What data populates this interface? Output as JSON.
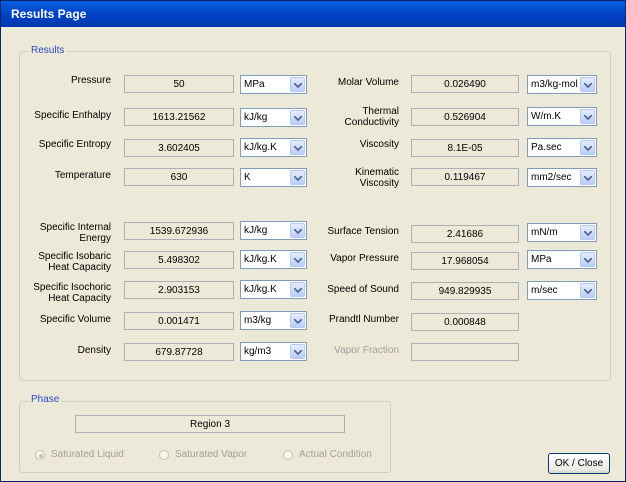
{
  "window": {
    "title": "Results Page"
  },
  "results": {
    "legend": "Results",
    "rows": [
      {
        "label": "Pressure",
        "value": "50",
        "unit": "MPa"
      },
      {
        "label": "Specific Enthalpy",
        "value": "1613.21562",
        "unit": "kJ/kg"
      },
      {
        "label": "Specific Entropy",
        "value": "3.602405",
        "unit": "kJ/kg.K"
      },
      {
        "label": "Temperature",
        "value": "630",
        "unit": "K"
      },
      {
        "label": "Specific Internal Energy",
        "value": "1539.672936",
        "unit": "kJ/kg"
      },
      {
        "label": "Specific Isobaric Heat Capacity",
        "value": "5.498302",
        "unit": "kJ/kg.K"
      },
      {
        "label": "Specific Isochoric Heat Capacity",
        "value": "2.903153",
        "unit": "kJ/kg.K"
      },
      {
        "label": "Specific Volume",
        "value": "0.001471",
        "unit": "m3/kg"
      },
      {
        "label": "Density",
        "value": "679.87728",
        "unit": "kg/m3"
      }
    ],
    "rows_right": [
      {
        "label": "Molar Volume",
        "value": "0.026490",
        "unit": "m3/kg-mol"
      },
      {
        "label": "Thermal Conductivity",
        "value": "0.526904",
        "unit": "W/m.K"
      },
      {
        "label": "Viscosity",
        "value": "8.1E-05",
        "unit": "Pa.sec"
      },
      {
        "label": "Kinematic Viscosity",
        "value": "0.119467",
        "unit": "mm2/sec"
      },
      {
        "label": "Surface Tension",
        "value": "2.41686",
        "unit": "mN/m"
      },
      {
        "label": "Vapor Pressure",
        "value": "17.968054",
        "unit": "MPa"
      },
      {
        "label": "Speed of Sound",
        "value": "949.829935",
        "unit": "m/sec"
      },
      {
        "label": "Prandtl Number",
        "value": "0.000848"
      },
      {
        "label": "Vapor Fraction",
        "value": ""
      }
    ]
  },
  "phase": {
    "legend": "Phase",
    "region": "Region 3",
    "options": [
      {
        "label": "Saturated Liquid",
        "selected": true
      },
      {
        "label": "Saturated Vapor",
        "selected": false
      },
      {
        "label": "Actual Condition",
        "selected": false
      }
    ]
  },
  "buttons": {
    "ok_close": "OK / Close"
  }
}
